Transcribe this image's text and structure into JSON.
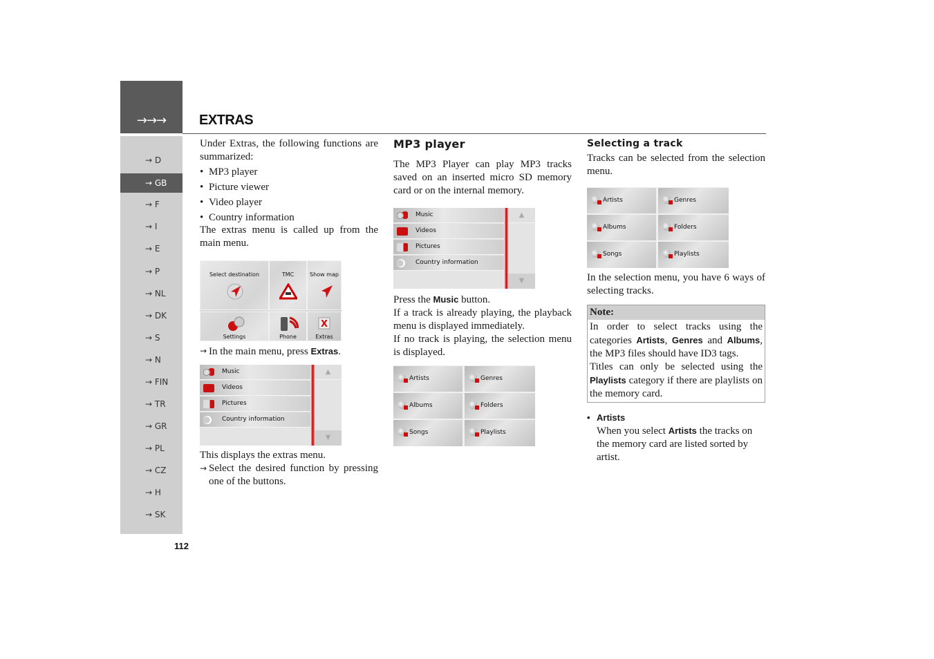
{
  "header": {
    "arrows": "→→→",
    "title": "EXTRAS"
  },
  "sidebar": {
    "items": [
      {
        "label": "→ D"
      },
      {
        "label": "→ GB",
        "active": true
      },
      {
        "label": "→ F"
      },
      {
        "label": "→ I"
      },
      {
        "label": "→ E"
      },
      {
        "label": "→ P"
      },
      {
        "label": "→ NL"
      },
      {
        "label": "→ DK"
      },
      {
        "label": "→ S"
      },
      {
        "label": "→ N"
      },
      {
        "label": "→ FIN"
      },
      {
        "label": "→ TR"
      },
      {
        "label": "→ GR"
      },
      {
        "label": "→ PL"
      },
      {
        "label": "→ CZ"
      },
      {
        "label": "→ H"
      },
      {
        "label": "→ SK"
      }
    ]
  },
  "page_number": "112",
  "col1": {
    "intro": "Under Extras, the following functions are summarized:",
    "bullets": [
      "MP3 player",
      "Picture viewer",
      "Video player",
      "Country information"
    ],
    "called_up": "The extras menu is called up from the main menu.",
    "main_menu_screen": {
      "cells": [
        "Select destination",
        "TMC",
        "Show map",
        "Settings",
        "Phone",
        "Extras"
      ]
    },
    "step1_arrow": "→",
    "step1_pre": "In the main menu, press ",
    "step1_bold": "Extras",
    "step1_post": ".",
    "extras_screen": {
      "rows": [
        "Music",
        "Videos",
        "Pictures",
        "Country information"
      ],
      "scroll_up": "▲",
      "scroll_down": "▼"
    },
    "displays": "This displays the extras menu.",
    "step2_arrow": "→",
    "step2": "Select the desired function by pressing one of the buttons."
  },
  "col2": {
    "heading": "MP3 player",
    "intro": "The MP3 Player can play MP3 tracks saved on an inserted micro SD memory card or on the internal memory.",
    "extras_screen": {
      "rows": [
        "Music",
        "Videos",
        "Pictures",
        "Country information"
      ],
      "scroll_up": "▲",
      "scroll_down": "▼"
    },
    "press_pre": "Press the ",
    "press_bold": "Music",
    "press_post": " button.",
    "playing": "If a track is already playing, the playback menu is displayed immediately.",
    "not_playing": "If no track is playing, the selection menu is displayed.",
    "selection_screen": {
      "cells": [
        "Artists",
        "Genres",
        "Albums",
        "Folders",
        "Songs",
        "Playlists"
      ]
    }
  },
  "col3": {
    "heading": "Selecting a track",
    "intro": "Tracks can be selected from the selection menu.",
    "selection_screen": {
      "cells": [
        "Artists",
        "Genres",
        "Albums",
        "Folders",
        "Songs",
        "Playlists"
      ]
    },
    "ways": "In the selection menu, you have 6 ways of selecting tracks.",
    "note": {
      "title": "Note:",
      "p1_a": "In order to select tracks using the categories ",
      "p1_b1": "Artists",
      "p1_c": ", ",
      "p1_b2": "Genres",
      "p1_d": " and ",
      "p1_b3": "Albums",
      "p1_e": ", the MP3 files should have ID3 tags.",
      "p2_a": "Titles can only be selected using the ",
      "p2_b": "Playlists",
      "p2_c": " category if there are playlists on the memory card."
    },
    "artists": {
      "heading": "Artists",
      "desc_a": "When you select ",
      "desc_b": "Artists",
      "desc_c": " the tracks on the memory card are listed sorted by artist."
    }
  },
  "colors": {
    "header_gray": "#5a5a5a",
    "sidebar_gray": "#cfcfcf",
    "accent_red": "#c00000"
  }
}
